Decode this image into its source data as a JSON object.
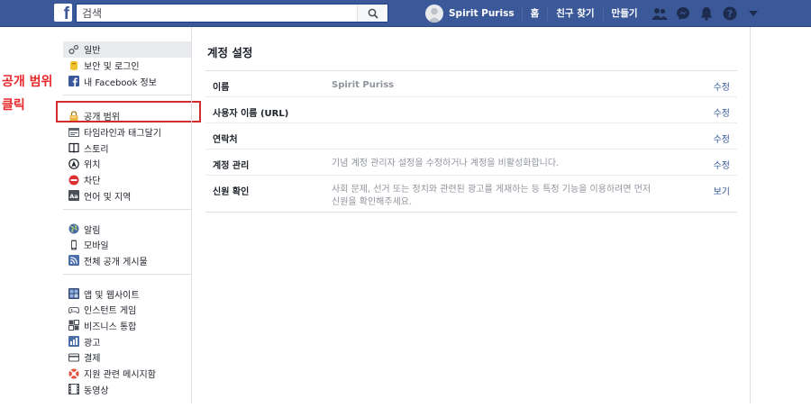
{
  "topbar": {
    "logo": "f",
    "search_placeholder": "검색",
    "profile_name": "Spirit Puriss",
    "home": "홈",
    "find_friends": "친구 찾기",
    "create": "만들기"
  },
  "annotation": {
    "line1": "공개 범위",
    "line2": "클릭"
  },
  "sidebar": {
    "groups": [
      [
        {
          "label": "일반",
          "icon": "gear-icon"
        },
        {
          "label": "보안 및 로그인",
          "icon": "badge-icon"
        },
        {
          "label": "내 Facebook 정보",
          "icon": "facebook-icon"
        }
      ],
      [
        {
          "label": "공개 범위",
          "icon": "lock-icon"
        },
        {
          "label": "타임라인과 태그달기",
          "icon": "timeline-icon"
        },
        {
          "label": "스토리",
          "icon": "book-icon"
        },
        {
          "label": "위치",
          "icon": "location-icon"
        },
        {
          "label": "차단",
          "icon": "block-icon"
        },
        {
          "label": "언어 및 지역",
          "icon": "language-icon"
        }
      ],
      [
        {
          "label": "알림",
          "icon": "globe-icon"
        },
        {
          "label": "모바일",
          "icon": "mobile-icon"
        },
        {
          "label": "전체 공개 게시물",
          "icon": "rss-icon"
        }
      ],
      [
        {
          "label": "앱 및 웹사이트",
          "icon": "apps-icon"
        },
        {
          "label": "인스턴트 게임",
          "icon": "gamepad-icon"
        },
        {
          "label": "비즈니스 통합",
          "icon": "business-icon"
        },
        {
          "label": "광고",
          "icon": "ads-icon"
        },
        {
          "label": "결제",
          "icon": "payment-icon"
        },
        {
          "label": "지원 관련 메시지함",
          "icon": "lifebuoy-icon"
        },
        {
          "label": "동영상",
          "icon": "video-icon"
        }
      ]
    ]
  },
  "content": {
    "title": "계정 설정",
    "rows": [
      {
        "label": "이름",
        "value": "Spirit Puriss",
        "action": "수정"
      },
      {
        "label": "사용자 이름 (URL)",
        "value": "",
        "action": "수정"
      },
      {
        "label": "연락처",
        "value": "",
        "action": "수정"
      },
      {
        "label": "계정 관리",
        "value": "기념 계정 관리자 설정을 수정하거나 계정을 비활성화합니다.",
        "action": "수정"
      },
      {
        "label": "신원 확인",
        "value": "사회 문제, 선거 또는 정치와 관련된 광고를 게재하는 등 특정 기능을 이용하려면 먼저 신원을 확인해주세요.",
        "action": "보기"
      }
    ]
  },
  "colors": {
    "topbar": "#3b5998",
    "link": "#365899",
    "highlight": "#d02c2c",
    "annotation": "#e8292c"
  }
}
